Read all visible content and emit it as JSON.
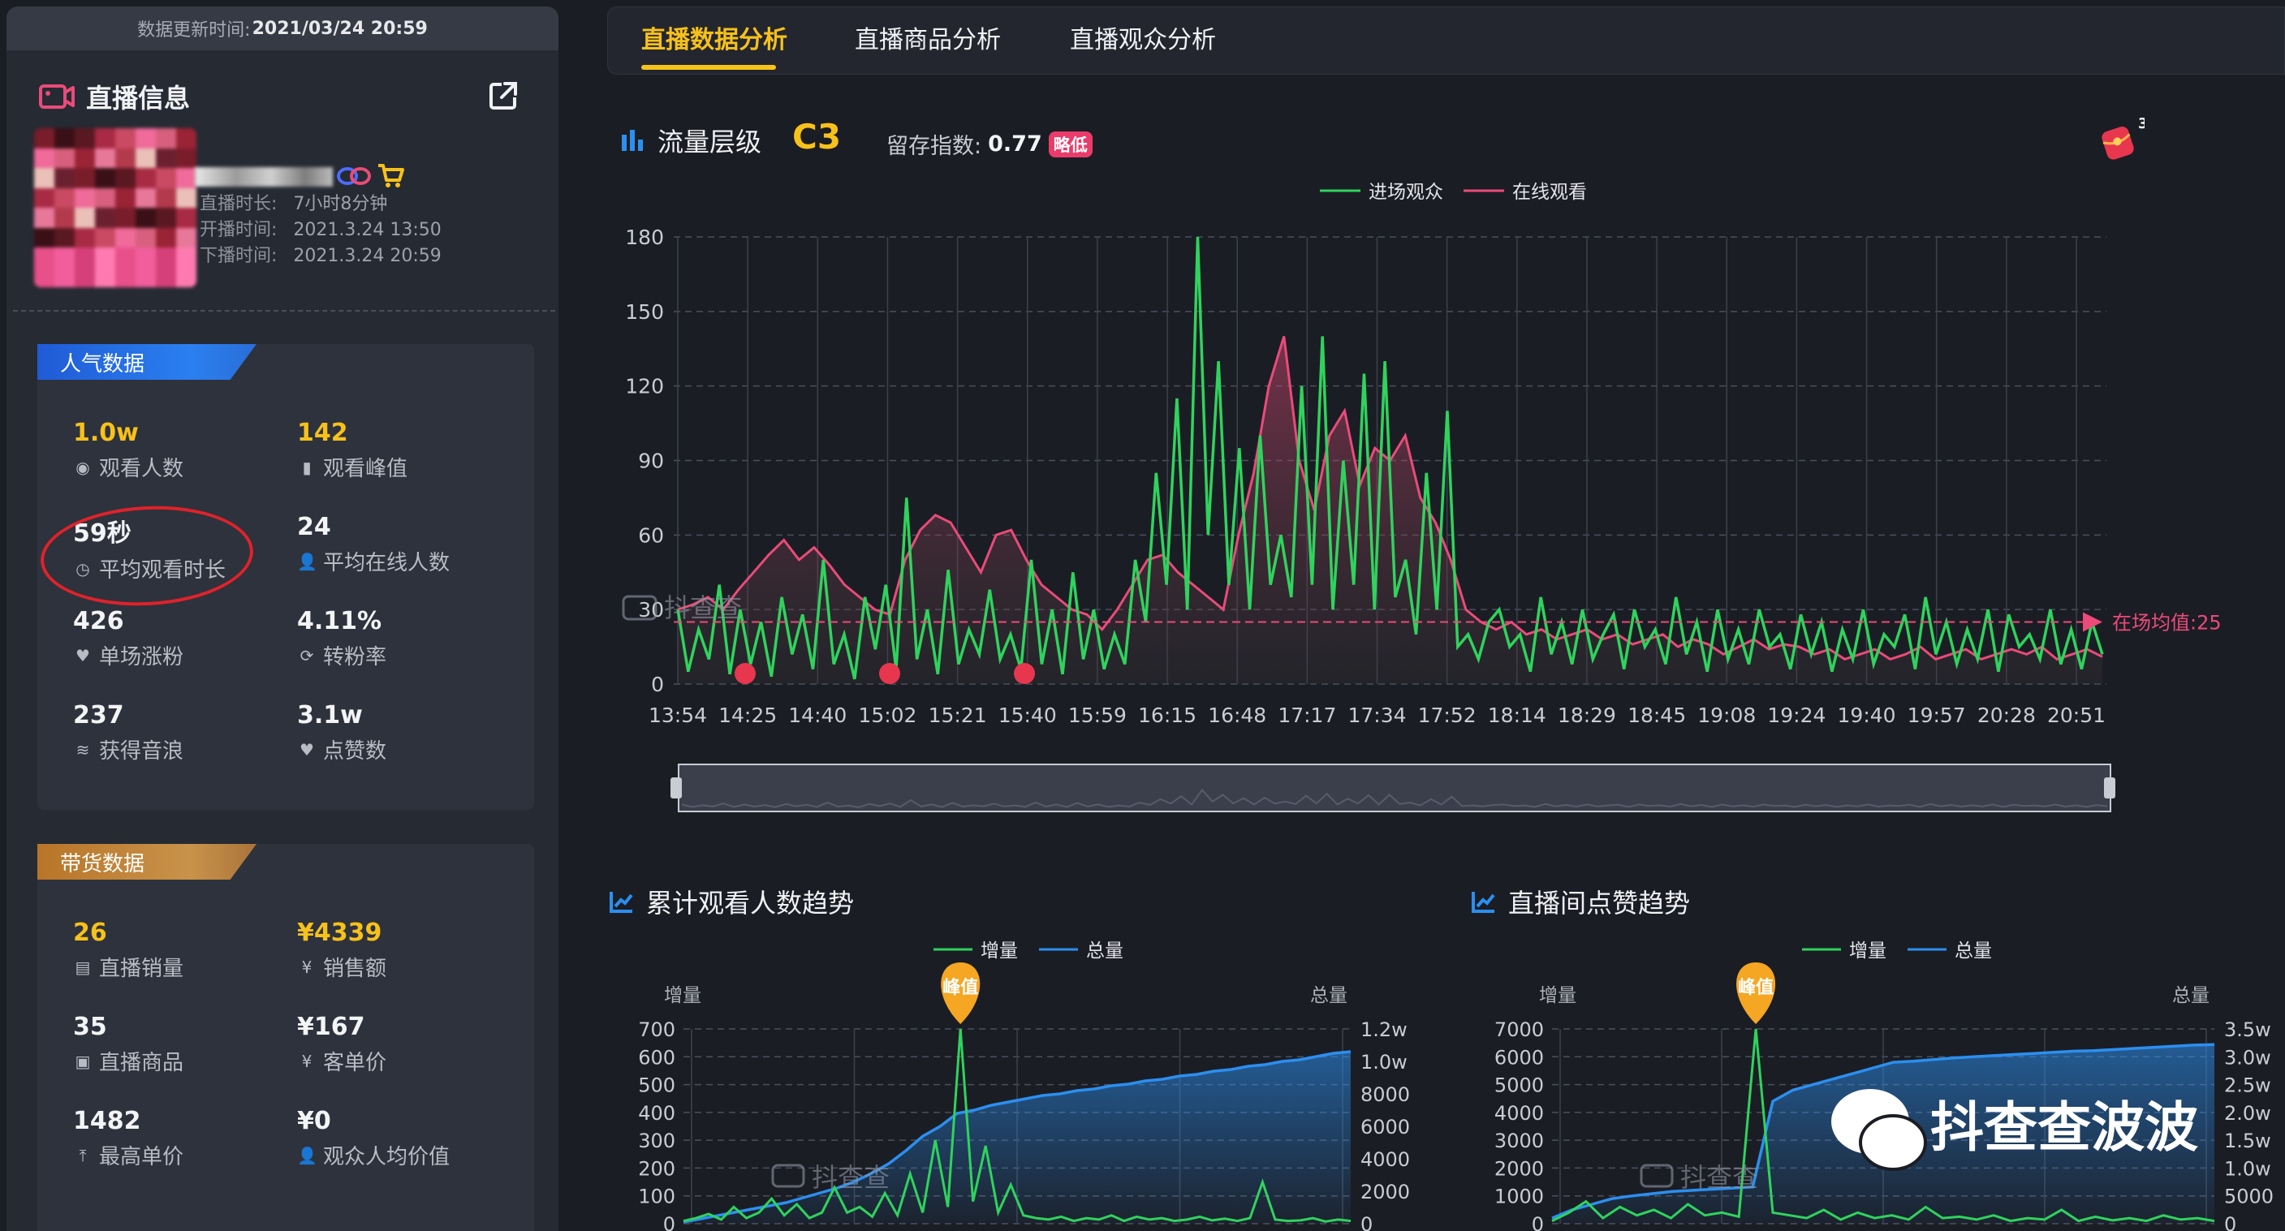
{
  "sidebar": {
    "update_label": "数据更新时间:",
    "update_time": "2021/03/24 20:59",
    "live_info_title": "直播信息",
    "meta": [
      {
        "label": "直播时长:",
        "value": "7小时8分钟"
      },
      {
        "label": "开播时间:",
        "value": "2021.3.24 13:50"
      },
      {
        "label": "下播时间:",
        "value": "2021.3.24 20:59"
      }
    ],
    "popularity": {
      "tag": "人气数据",
      "stats": [
        {
          "value": "1.0w",
          "label": "观看人数",
          "icon": "eye-icon"
        },
        {
          "value": "142",
          "label": "观看峰值",
          "icon": "bar-icon"
        },
        {
          "value": "59秒",
          "label": "平均观看时长",
          "icon": "clock-icon"
        },
        {
          "value": "24",
          "label": "平均在线人数",
          "icon": "users-icon"
        },
        {
          "value": "426",
          "label": "单场涨粉",
          "icon": "heart-plus-icon"
        },
        {
          "value": "4.11%",
          "label": "转粉率",
          "icon": "convert-icon"
        },
        {
          "value": "237",
          "label": "获得音浪",
          "icon": "wave-icon"
        },
        {
          "value": "3.1w",
          "label": "点赞数",
          "icon": "heart-icon"
        }
      ]
    },
    "sales": {
      "tag": "带货数据",
      "stats": [
        {
          "value": "26",
          "label": "直播销量",
          "icon": "goods-icon"
        },
        {
          "value": "¥4339",
          "label": "销售额",
          "icon": "yuan-circle-icon"
        },
        {
          "value": "35",
          "label": "直播商品",
          "icon": "box-icon"
        },
        {
          "value": "¥167",
          "label": "客单价",
          "icon": "yuan-icon"
        },
        {
          "value": "1482",
          "label": "最高单价",
          "icon": "arrow-up-icon"
        },
        {
          "value": "¥0",
          "label": "观众人均价值",
          "icon": "user-yuan-icon"
        }
      ]
    }
  },
  "tabs": [
    "直播数据分析",
    "直播商品分析",
    "直播观众分析"
  ],
  "traffic": {
    "title": "流量层级",
    "level": "C3",
    "retain_label": "留存指数:",
    "retain_value": "0.77",
    "retain_badge": "略低",
    "gift_count": "3",
    "watermark": "抖查查",
    "avg_label": "在场均值:25"
  },
  "bottom_left": {
    "title": "累计观看人数趋势",
    "left_axis": "增量",
    "right_axis": "总量",
    "peak": "峰值"
  },
  "bottom_right": {
    "title": "直播间点赞趋势",
    "left_axis": "增量",
    "right_axis": "总量",
    "peak": "峰值"
  },
  "wechat_watermark": "抖查查波波",
  "colors": {
    "accent": "#f7c11b",
    "green": "#2fd35d",
    "pink": "#ea4b79",
    "blue": "#2b8ff0",
    "bg": "#1b1d24"
  },
  "chart_data": [
    {
      "type": "line",
      "title": "",
      "legend": [
        "进场观众",
        "在线观看"
      ],
      "x_ticks": [
        "13:54",
        "14:25",
        "14:40",
        "15:02",
        "15:21",
        "15:40",
        "15:59",
        "16:15",
        "16:48",
        "17:17",
        "17:34",
        "17:52",
        "18:14",
        "18:29",
        "18:45",
        "19:08",
        "19:24",
        "19:40",
        "19:57",
        "20:28",
        "20:51"
      ],
      "ylim": [
        0,
        180
      ],
      "y_ticks": [
        0,
        30,
        60,
        90,
        120,
        150,
        180
      ],
      "reference_line": 25,
      "series": [
        {
          "name": "进场观众",
          "values": [
            30,
            5,
            22,
            10,
            40,
            4,
            30,
            8,
            25,
            3,
            35,
            12,
            28,
            6,
            50,
            8,
            20,
            2,
            35,
            14,
            40,
            6,
            75,
            10,
            30,
            4,
            46,
            8,
            22,
            12,
            38,
            10,
            20,
            6,
            50,
            8,
            30,
            4,
            45,
            10,
            30,
            6,
            20,
            8,
            50,
            25,
            85,
            40,
            115,
            30,
            180,
            60,
            130,
            40,
            95,
            30,
            100,
            40,
            60,
            35,
            120,
            40,
            140,
            30,
            90,
            40,
            125,
            30,
            130,
            35,
            50,
            20,
            85,
            30,
            110,
            15,
            20,
            10,
            25,
            30,
            15,
            20,
            5,
            35,
            12,
            25,
            8,
            30,
            10,
            20,
            28,
            6,
            30,
            15,
            22,
            8,
            35,
            12,
            25,
            5,
            30,
            10,
            22,
            8,
            30,
            15,
            20,
            6,
            28,
            12,
            25,
            5,
            22,
            10,
            30,
            8,
            20,
            15,
            28,
            6,
            35,
            12,
            25,
            8,
            22,
            10,
            30,
            5,
            28,
            15,
            20,
            10,
            30,
            8,
            22,
            6,
            25,
            12
          ]
        },
        {
          "name": "在线观看",
          "values": [
            30,
            32,
            35,
            30,
            38,
            45,
            52,
            58,
            50,
            55,
            48,
            40,
            35,
            30,
            28,
            50,
            62,
            68,
            65,
            55,
            45,
            60,
            62,
            50,
            40,
            35,
            30,
            28,
            22,
            30,
            40,
            50,
            52,
            45,
            40,
            35,
            30,
            60,
            85,
            120,
            140,
            90,
            70,
            100,
            110,
            80,
            95,
            90,
            100,
            75,
            65,
            50,
            30,
            25,
            22,
            25,
            20,
            22,
            18,
            20,
            22,
            18,
            20,
            16,
            18,
            20,
            15,
            18,
            16,
            12,
            15,
            18,
            14,
            16,
            15,
            12,
            14,
            10,
            12,
            14,
            10,
            12,
            15,
            10,
            12,
            14,
            10,
            12,
            14,
            12,
            15,
            10,
            12,
            14,
            11
          ]
        }
      ]
    },
    {
      "type": "line",
      "title": "",
      "legend": [
        "增量",
        "总量"
      ],
      "ylim_left": [
        0,
        700
      ],
      "y_ticks_left": [
        0,
        100,
        200,
        300,
        400,
        500,
        600,
        700
      ],
      "y_ticks_right": [
        "0",
        "2000",
        "4000",
        "6000",
        "8000",
        "1.0w",
        "1.2w"
      ],
      "ylim_right": [
        0,
        12000
      ],
      "series": [
        {
          "name": "增量",
          "values": [
            10,
            20,
            35,
            15,
            60,
            20,
            40,
            90,
            30,
            70,
            20,
            40,
            130,
            40,
            60,
            25,
            110,
            30,
            180,
            40,
            300,
            60,
            700,
            80,
            280,
            40,
            140,
            30,
            20,
            15,
            25,
            10,
            20,
            15,
            30,
            10,
            25,
            15,
            20,
            10,
            15,
            25,
            12,
            18,
            10,
            20,
            150,
            15,
            10,
            12,
            20,
            8,
            15,
            10
          ]
        },
        {
          "name": "总量",
          "values": [
            100,
            300,
            500,
            700,
            900,
            1100,
            1300,
            1600,
            1900,
            2200,
            2600,
            3100,
            3700,
            4500,
            5400,
            6000,
            6800,
            7000,
            7300,
            7500,
            7700,
            7900,
            8000,
            8200,
            8300,
            8500,
            8600,
            8800,
            8900,
            9100,
            9200,
            9400,
            9500,
            9700,
            9800,
            10000,
            10100,
            10300,
            10500,
            10600
          ]
        }
      ]
    },
    {
      "type": "line",
      "title": "",
      "legend": [
        "增量",
        "总量"
      ],
      "ylim_left": [
        0,
        7000
      ],
      "y_ticks_left": [
        0,
        1000,
        2000,
        3000,
        4000,
        5000,
        6000,
        7000
      ],
      "y_ticks_right": [
        "0",
        "5000",
        "1.0w",
        "1.5w",
        "2.0w",
        "2.5w",
        "3.0w",
        "3.5w"
      ],
      "ylim_right": [
        0,
        35000
      ],
      "series": [
        {
          "name": "增量",
          "values": [
            100,
            400,
            800,
            200,
            600,
            300,
            500,
            200,
            700,
            300,
            400,
            250,
            7000,
            400,
            300,
            200,
            500,
            150,
            400,
            200,
            300,
            150,
            600,
            200,
            250,
            150,
            300,
            100,
            200,
            150,
            500,
            100,
            250,
            120,
            200,
            100,
            300,
            150,
            200,
            100
          ]
        },
        {
          "name": "总量",
          "values": [
            1000,
            2500,
            3500,
            4500,
            5000,
            5400,
            5800,
            6000,
            6200,
            6400,
            6600,
            22000,
            24000,
            25000,
            26000,
            27000,
            28000,
            29000,
            29200,
            29500,
            29800,
            30000,
            30200,
            30400,
            30600,
            30800,
            31000,
            31100,
            31300,
            31500,
            31700,
            31900,
            32100,
            32200
          ]
        }
      ]
    }
  ]
}
